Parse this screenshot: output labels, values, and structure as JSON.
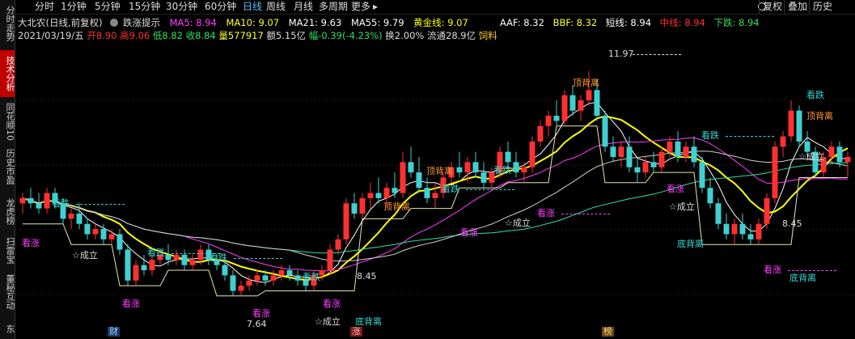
{
  "sidebar": {
    "tabs": [
      {
        "label": "分时走势",
        "active": false
      },
      {
        "label": "技术分析",
        "active": true
      },
      {
        "label": "同花顺10",
        "active": false
      },
      {
        "label": "历史市盈",
        "active": false
      },
      {
        "label": "龙虎榜",
        "active": false
      },
      {
        "label": "扫雷宝",
        "active": false
      },
      {
        "label": "董秘互动",
        "active": false
      },
      {
        "label": "东",
        "active": false
      }
    ]
  },
  "toolbar": {
    "periods": [
      "分时",
      "1分钟",
      "5分钟",
      "15分钟",
      "30分钟",
      "60分钟",
      "日线",
      "周线",
      "月线",
      "多周期",
      "更多"
    ],
    "active_period": "日线",
    "more_arrow": "▸",
    "search_icon": "search-icon",
    "right_buttons": [
      "复权",
      "叠加",
      "历史"
    ]
  },
  "info": {
    "title": "大北农(日线,前复权)",
    "hint_icon": "gear-icon",
    "hint": "跌涨提示",
    "ma5": "MA5: 8.94",
    "ma10": "MA10: 9.07",
    "ma21": "MA21: 9.63",
    "ma55": "MA55: 9.79",
    "gold": "黄金线: 9.07",
    "aaf": "AAF: 8.32",
    "bbf": "BBF: 8.32",
    "short": "短线: 8.94",
    "mid": "中线: 8.94",
    "down": "下跌: 8.94",
    "line2_date": "2021/03/19/五",
    "open": "开8.90",
    "high": "高9.06",
    "low": "低8.82",
    "close": "收8.84",
    "volume": "量577917",
    "amount": "额5.15亿",
    "change": "幅-0.39(-4.23%)",
    "turnover": "换2.00%",
    "float": "流通28.9亿",
    "industry": "饲料"
  },
  "colors": {
    "up": "#ff3030",
    "down": "#40d0d0",
    "ma5": "#ffffff",
    "ma10": "#ffff33",
    "ma21": "#ff40ff",
    "ma55": "#30e0a0",
    "gold": "#ffff00",
    "magenta": "#ff40ff",
    "orange": "#ff9a2e",
    "cyan": "#38d6d6"
  },
  "chart_data": {
    "type": "candlestick",
    "ylim": [
      7.0,
      12.5
    ],
    "candles": [
      [
        9.4,
        9.6,
        9.2,
        9.5
      ],
      [
        9.5,
        9.7,
        9.3,
        9.4
      ],
      [
        9.4,
        9.6,
        9.2,
        9.3
      ],
      [
        9.3,
        9.7,
        9.2,
        9.6
      ],
      [
        9.6,
        9.7,
        9.3,
        9.4
      ],
      [
        9.4,
        9.5,
        9.0,
        9.1
      ],
      [
        9.1,
        9.3,
        8.9,
        9.2
      ],
      [
        9.2,
        9.4,
        8.9,
        9.0
      ],
      [
        9.0,
        9.1,
        8.7,
        8.8
      ],
      [
        8.8,
        9.0,
        8.7,
        8.9
      ],
      [
        8.9,
        9.0,
        8.6,
        8.7
      ],
      [
        8.7,
        8.9,
        8.6,
        8.8
      ],
      [
        8.8,
        8.9,
        8.4,
        8.5
      ],
      [
        8.5,
        8.6,
        7.8,
        7.9
      ],
      [
        7.9,
        8.3,
        7.8,
        8.2
      ],
      [
        8.2,
        8.4,
        8.0,
        8.1
      ],
      [
        8.1,
        8.4,
        8.0,
        8.3
      ],
      [
        8.3,
        8.5,
        8.2,
        8.4
      ],
      [
        8.4,
        8.6,
        8.2,
        8.3
      ],
      [
        8.3,
        8.5,
        8.2,
        8.4
      ],
      [
        8.4,
        8.5,
        8.1,
        8.2
      ],
      [
        8.2,
        8.4,
        8.1,
        8.3
      ],
      [
        8.3,
        8.6,
        8.2,
        8.5
      ],
      [
        8.5,
        8.6,
        8.2,
        8.3
      ],
      [
        8.3,
        8.4,
        8.1,
        8.2
      ],
      [
        8.2,
        8.3,
        7.9,
        8.0
      ],
      [
        8.0,
        8.1,
        7.6,
        7.7
      ],
      [
        7.7,
        7.9,
        7.6,
        7.8
      ],
      [
        7.8,
        8.0,
        7.7,
        7.9
      ],
      [
        7.9,
        8.1,
        7.8,
        8.0
      ],
      [
        8.0,
        8.1,
        7.8,
        7.9
      ],
      [
        7.9,
        8.1,
        7.8,
        8.0
      ],
      [
        8.0,
        8.2,
        7.9,
        8.1
      ],
      [
        8.1,
        8.2,
        7.9,
        8.0
      ],
      [
        8.0,
        8.1,
        7.8,
        7.9
      ],
      [
        7.9,
        8.0,
        7.7,
        7.8
      ],
      [
        7.8,
        8.1,
        7.7,
        8.0
      ],
      [
        8.0,
        8.2,
        7.9,
        8.1
      ],
      [
        8.1,
        8.6,
        8.0,
        8.5
      ],
      [
        8.5,
        8.8,
        8.4,
        8.7
      ],
      [
        8.7,
        9.5,
        8.6,
        9.4
      ],
      [
        9.4,
        9.6,
        9.1,
        9.2
      ],
      [
        9.2,
        9.6,
        9.1,
        9.5
      ],
      [
        9.5,
        9.8,
        9.3,
        9.6
      ],
      [
        9.6,
        9.9,
        9.4,
        9.5
      ],
      [
        9.5,
        9.8,
        9.3,
        9.7
      ],
      [
        9.7,
        10.0,
        9.5,
        9.6
      ],
      [
        9.6,
        10.4,
        9.5,
        10.2
      ],
      [
        10.2,
        10.5,
        9.9,
        10.0
      ],
      [
        10.0,
        10.3,
        9.6,
        9.7
      ],
      [
        9.7,
        9.9,
        9.4,
        9.5
      ],
      [
        9.5,
        9.8,
        9.3,
        9.6
      ],
      [
        9.6,
        10.0,
        9.5,
        9.9
      ],
      [
        9.9,
        10.2,
        9.8,
        10.1
      ],
      [
        10.1,
        10.4,
        9.9,
        10.0
      ],
      [
        10.0,
        10.3,
        9.8,
        10.2
      ],
      [
        10.2,
        10.4,
        9.9,
        10.0
      ],
      [
        10.0,
        10.2,
        9.7,
        9.8
      ],
      [
        9.8,
        10.1,
        9.7,
        10.0
      ],
      [
        10.0,
        10.5,
        9.9,
        10.4
      ],
      [
        10.4,
        10.6,
        10.1,
        10.2
      ],
      [
        10.2,
        10.4,
        9.9,
        10.0
      ],
      [
        10.0,
        10.2,
        9.8,
        10.1
      ],
      [
        10.1,
        10.7,
        10.0,
        10.6
      ],
      [
        10.6,
        11.0,
        10.5,
        10.9
      ],
      [
        10.9,
        11.2,
        10.7,
        11.1
      ],
      [
        11.1,
        11.4,
        10.9,
        11.0
      ],
      [
        11.0,
        11.6,
        10.9,
        11.5
      ],
      [
        11.5,
        11.7,
        11.1,
        11.2
      ],
      [
        11.2,
        11.5,
        11.0,
        11.4
      ],
      [
        11.4,
        11.97,
        11.3,
        11.6
      ],
      [
        11.6,
        11.8,
        11.0,
        11.1
      ],
      [
        11.1,
        11.2,
        10.4,
        10.5
      ],
      [
        10.5,
        10.7,
        10.2,
        10.3
      ],
      [
        10.3,
        10.6,
        10.1,
        10.5
      ],
      [
        10.5,
        10.7,
        10.0,
        10.1
      ],
      [
        10.1,
        10.3,
        9.8,
        10.0
      ],
      [
        10.0,
        10.3,
        9.9,
        10.2
      ],
      [
        10.2,
        10.4,
        10.0,
        10.1
      ],
      [
        10.1,
        10.5,
        10.0,
        10.4
      ],
      [
        10.4,
        10.7,
        10.3,
        10.6
      ],
      [
        10.6,
        10.8,
        10.2,
        10.3
      ],
      [
        10.3,
        10.6,
        10.2,
        10.5
      ],
      [
        10.5,
        10.7,
        10.1,
        10.2
      ],
      [
        10.2,
        10.3,
        9.6,
        9.7
      ],
      [
        9.7,
        9.9,
        9.3,
        9.4
      ],
      [
        9.4,
        9.5,
        8.9,
        9.0
      ],
      [
        9.0,
        9.2,
        8.7,
        8.8
      ],
      [
        8.8,
        9.1,
        8.6,
        9.0
      ],
      [
        9.0,
        9.2,
        8.7,
        8.8
      ],
      [
        8.8,
        9.0,
        8.6,
        8.7
      ],
      [
        8.7,
        9.1,
        8.6,
        9.0
      ],
      [
        9.0,
        9.6,
        8.9,
        9.5
      ],
      [
        9.5,
        10.6,
        9.4,
        10.5
      ],
      [
        10.5,
        10.8,
        10.3,
        10.7
      ],
      [
        10.7,
        11.4,
        10.6,
        11.2
      ],
      [
        11.2,
        11.3,
        10.5,
        10.6
      ],
      [
        10.6,
        10.8,
        10.3,
        10.4
      ],
      [
        10.4,
        10.5,
        9.9,
        10.0
      ],
      [
        10.0,
        10.4,
        9.9,
        10.3
      ],
      [
        10.3,
        10.6,
        10.2,
        10.5
      ],
      [
        10.5,
        10.6,
        10.1,
        10.2
      ],
      [
        10.2,
        10.4,
        9.9,
        10.3
      ]
    ]
  },
  "markers": [
    {
      "text": "看跌",
      "x": 45,
      "y": 192,
      "color": "#38d6d6",
      "dash": true
    },
    {
      "text": "看涨",
      "x": 8,
      "y": 241,
      "color": "#ff40ff",
      "dash": false
    },
    {
      "text": "☆成立",
      "x": 70,
      "y": 256,
      "color": "#dddddd",
      "dash": false
    },
    {
      "text": "看跌",
      "x": 163,
      "y": 253,
      "color": "#38d6d6",
      "dash": true
    },
    {
      "text": "看跌",
      "x": 240,
      "y": 259,
      "color": "#38d6d6",
      "dash": true
    },
    {
      "text": "看涨",
      "x": 132,
      "y": 316,
      "color": "#ff40ff",
      "dash": false
    },
    {
      "text": "看跌",
      "x": 355,
      "y": 283,
      "color": "#38d6d6",
      "dash": false
    },
    {
      "text": "看涨",
      "x": 293,
      "y": 328,
      "color": "#ff40ff",
      "dash": false
    },
    {
      "text": "看涨",
      "x": 380,
      "y": 316,
      "color": "#ff40ff",
      "dash": false
    },
    {
      "text": "☆成立",
      "x": 370,
      "y": 338,
      "color": "#dddddd",
      "dash": false
    },
    {
      "text": "7.64",
      "x": 286,
      "y": 341,
      "color": "#dddddd",
      "dash": false
    },
    {
      "text": "底背离",
      "x": 420,
      "y": 338,
      "color": "#38d6d6",
      "dash": false
    },
    {
      "text": "顶背离",
      "x": 455,
      "y": 196,
      "color": "#ff9a2e",
      "dash": false
    },
    {
      "text": "顶背离",
      "x": 508,
      "y": 152,
      "color": "#ff9a2e",
      "dash": false
    },
    {
      "text": "看跌",
      "x": 527,
      "y": 174,
      "color": "#38d6d6",
      "dash": true
    },
    {
      "text": "看跌",
      "x": 591,
      "y": 151,
      "color": "#38d6d6",
      "dash": false
    },
    {
      "text": "看涨",
      "x": 550,
      "y": 228,
      "color": "#ff40ff",
      "dash": false
    },
    {
      "text": "看涨",
      "x": 645,
      "y": 204,
      "color": "#ff40ff",
      "dash": true
    },
    {
      "text": "☆成立",
      "x": 605,
      "y": 216,
      "color": "#dddddd",
      "dash": false
    },
    {
      "text": "顶背离",
      "x": 689,
      "y": 43,
      "color": "#ff9a2e",
      "dash": false
    },
    {
      "text": "11.97",
      "x": 733,
      "y": 7,
      "color": "#dddddd",
      "dash": true
    },
    {
      "text": "看涨",
      "x": 805,
      "y": 174,
      "color": "#ff40ff",
      "dash": false
    },
    {
      "text": "☆成立",
      "x": 808,
      "y": 196,
      "color": "#dddddd",
      "dash": false
    },
    {
      "text": "看跌",
      "x": 848,
      "y": 108,
      "color": "#38d6d6",
      "dash": true
    },
    {
      "text": "底背离",
      "x": 818,
      "y": 242,
      "color": "#38d6d6",
      "dash": false
    },
    {
      "text": "看涨",
      "x": 925,
      "y": 274,
      "color": "#ff40ff",
      "dash": true
    },
    {
      "text": "底背离",
      "x": 957,
      "y": 284,
      "color": "#38d6d6",
      "dash": false
    },
    {
      "text": "看跌",
      "x": 978,
      "y": 58,
      "color": "#38d6d6",
      "dash": false
    },
    {
      "text": "顶背离",
      "x": 978,
      "y": 84,
      "color": "#ff9a2e",
      "dash": false
    },
    {
      "text": "☆成立",
      "x": 968,
      "y": 134,
      "color": "#dddddd",
      "dash": false
    },
    {
      "text": "8.45",
      "x": 948,
      "y": 217,
      "color": "#dddddd",
      "dash": false
    },
    {
      "text": "8.45",
      "x": 422,
      "y": 282,
      "color": "#dddddd",
      "dash": false
    }
  ],
  "bottom_marks": [
    {
      "text": "财",
      "x": 133,
      "bg": "#1a3a6a",
      "color": "#9fd0ff"
    },
    {
      "text": "涨",
      "x": 433,
      "bg": "#7a1a1a",
      "color": "#ffb0b0"
    },
    {
      "text": "榜",
      "x": 744,
      "bg": "#6a4a10",
      "color": "#ffd28a"
    }
  ]
}
